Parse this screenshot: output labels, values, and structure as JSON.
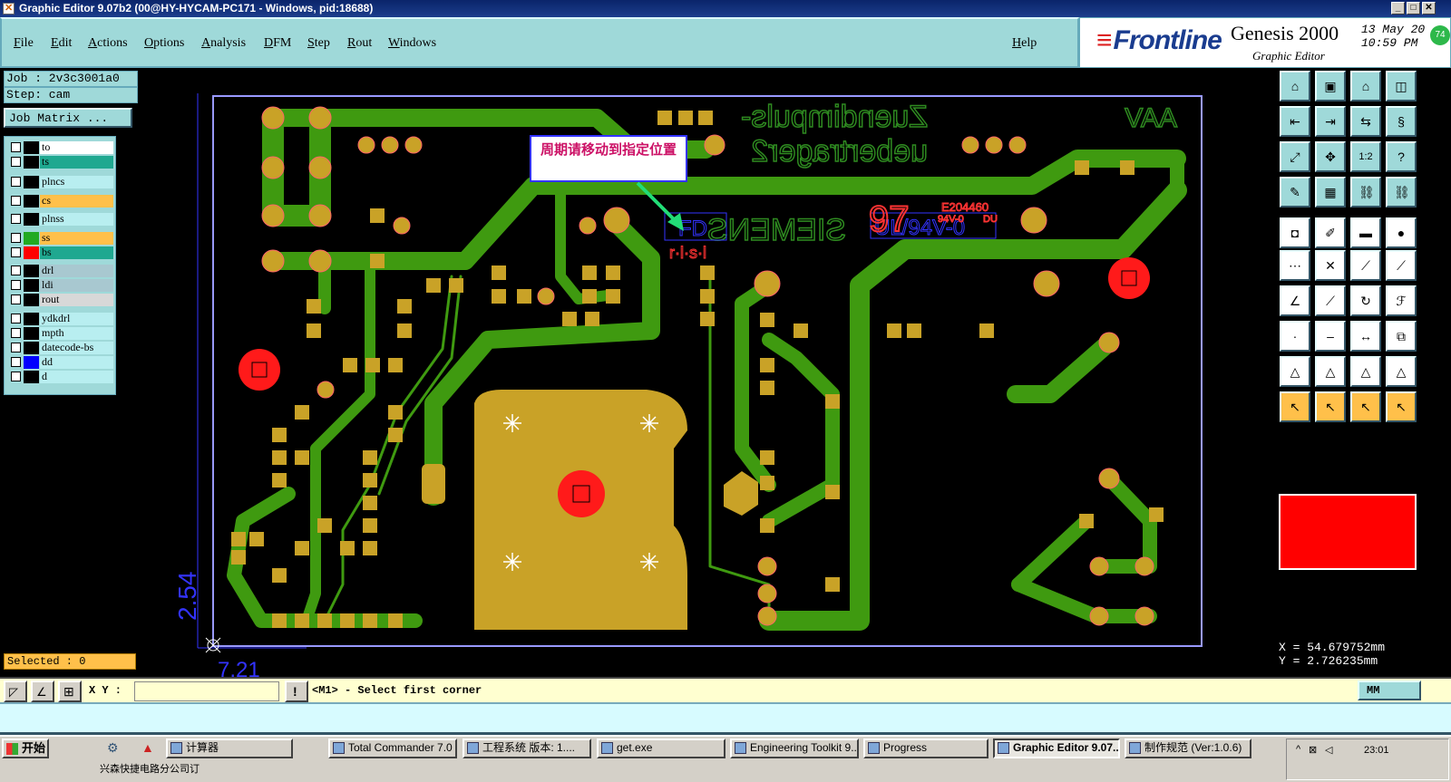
{
  "window": {
    "title": "Graphic Editor 9.07b2 (00@HY-HYCAM-PC171 - Windows, pid:18688)",
    "controls": [
      "_",
      "□",
      "✕"
    ]
  },
  "menu": {
    "items": [
      "File",
      "Edit",
      "Actions",
      "Options",
      "Analysis",
      "DFM",
      "Step",
      "Rout",
      "Windows"
    ],
    "help": "Help"
  },
  "brand": {
    "logo": "Frontline",
    "product": "Genesis 2000",
    "subtitle": "Graphic Editor",
    "date": "13 May 20",
    "time": "10:59 PM",
    "badge": "74"
  },
  "left_panel": {
    "job": "Job : 2v3c3001a0",
    "step": "Step: cam",
    "job_matrix": "Job Matrix ...",
    "selected": "Selected : 0",
    "layers": [
      {
        "name": "to",
        "swatch": "#000000",
        "bg": "#ffffff"
      },
      {
        "name": "ts",
        "swatch": "#000000",
        "bg": "#1fa890"
      },
      {
        "name": "plncs",
        "swatch": "#000000",
        "bg": "#b8eef0"
      },
      {
        "name": "cs",
        "swatch": "#000000",
        "bg": "#ffc04a"
      },
      {
        "name": "plnss",
        "swatch": "#000000",
        "bg": "#b8eef0"
      },
      {
        "name": "ss",
        "swatch": "#22aa22",
        "bg": "#ffc04a"
      },
      {
        "name": "bs",
        "swatch": "#ff0000",
        "bg": "#1fa890"
      },
      {
        "name": "drl",
        "swatch": "#000000",
        "bg": "#a8c8d0"
      },
      {
        "name": "ldi",
        "swatch": "#000000",
        "bg": "#a8c8d0"
      },
      {
        "name": "rout",
        "swatch": "#000000",
        "bg": "#d8d8d8"
      },
      {
        "name": "ydkdrl",
        "swatch": "#000000",
        "bg": "#b8eef0"
      },
      {
        "name": "mpth",
        "swatch": "#000000",
        "bg": "#b8eef0"
      },
      {
        "name": "datecode-bs",
        "swatch": "#000000",
        "bg": "#b8eef0"
      },
      {
        "name": "dd",
        "swatch": "#0000ff",
        "bg": "#b8eef0"
      },
      {
        "name": "d",
        "swatch": "#000000",
        "bg": "#b8eef0"
      }
    ]
  },
  "canvas": {
    "callout": "周期请移动到指定位置",
    "silk_line1": "Zuendimpuls-",
    "silk_line2": "uebertrager2",
    "silk_siemens": "SIEMENS",
    "silk_aav": "AAV",
    "silk_fd": "FD",
    "silk_ul": "UL/94V-0",
    "silk_code": "E204460",
    "silk_small1": "DU",
    "silk_small2": "94V-0",
    "silk_big": "97",
    "dim_vertical": "2.54",
    "dim_horizontal": "7.21"
  },
  "colors": {
    "trace": "#3f9a10",
    "pad": "#c9a227",
    "red": "#ff1a1a",
    "outline": "#9999ff",
    "silk": "#2e8a20",
    "dim": "#3333ff"
  },
  "coords": {
    "x": "X  =  54.679752mm",
    "y": "Y  =  2.726235mm"
  },
  "command_bar": {
    "xy_label": "X Y :",
    "xy_value": "",
    "message": "<M1> - Select first corner",
    "units": "MM"
  },
  "taskbar": {
    "start": "开始",
    "tasks": [
      "计算器",
      "Total Commander 7.0 ...",
      "工程系统  版本: 1....",
      "get.exe",
      "Engineering Toolkit 9....",
      "Progress",
      "Graphic Editor 9.07...",
      "制作规范 (Ver:1.0.6)"
    ],
    "clock": "23:01",
    "subtask": "兴森快捷电路分公司订"
  }
}
